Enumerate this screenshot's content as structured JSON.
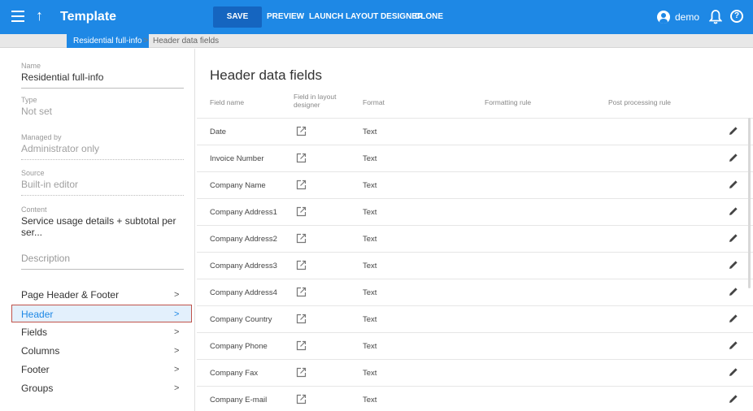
{
  "app": {
    "title": "Template",
    "up_icon": "arrow-up-icon",
    "menu_icon": "hamburger-menu-icon"
  },
  "toolbar": {
    "save_label": "SAVE",
    "preview_label": "PREVIEW",
    "launch_label": "LAUNCH LAYOUT DESIGNER",
    "clone_label": "CLONE"
  },
  "user": {
    "name": "demo",
    "icon": "account-icon",
    "bell_icon": "bell-icon",
    "help_icon": "help-icon"
  },
  "breadcrumb": {
    "current": "Residential full-info",
    "separator": ">",
    "sub": "Header data fields"
  },
  "details": {
    "name": {
      "label": "Name",
      "value": "Residential full-info"
    },
    "type": {
      "label": "Type",
      "value": "Not set"
    },
    "managed_by": {
      "label": "Managed by",
      "value": "Administrator only"
    },
    "source": {
      "label": "Source",
      "value": "Built-in editor"
    },
    "content": {
      "label": "Content",
      "value": "Service usage details + subtotal per ser..."
    },
    "description_placeholder": "Description"
  },
  "sections": [
    {
      "label": "Page Header & Footer",
      "chevron": ">"
    },
    {
      "label": "Header",
      "chevron": ">",
      "active": true
    },
    {
      "label": "Fields",
      "chevron": ">"
    },
    {
      "label": "Columns",
      "chevron": ">"
    },
    {
      "label": "Footer",
      "chevron": ">"
    },
    {
      "label": "Groups",
      "chevron": ">"
    }
  ],
  "main": {
    "title": "Header data fields",
    "columns": {
      "field_name": "Field name",
      "layout_line1": "Field in layout",
      "layout_line2": "designer",
      "format": "Format",
      "formatting_rule": "Formatting rule",
      "post_processing_rule": "Post processing rule"
    },
    "rows": [
      {
        "field": "Date",
        "format": "Text"
      },
      {
        "field": "Invoice Number",
        "format": "Text"
      },
      {
        "field": "Company Name",
        "format": "Text"
      },
      {
        "field": "Company Address1",
        "format": "Text"
      },
      {
        "field": "Company Address2",
        "format": "Text"
      },
      {
        "field": "Company Address3",
        "format": "Text"
      },
      {
        "field": "Company Address4",
        "format": "Text"
      },
      {
        "field": "Company Country",
        "format": "Text"
      },
      {
        "field": "Company Phone",
        "format": "Text"
      },
      {
        "field": "Company Fax",
        "format": "Text"
      },
      {
        "field": "Company E-mail",
        "format": "Text"
      }
    ],
    "row_link_icon": "open-in-layout-designer-icon",
    "row_edit_icon": "pencil-edit-icon"
  },
  "colors": {
    "primary": "#1e88e5",
    "save_button": "#1565c0",
    "active_border": "#c0524a",
    "active_background": "#e3f0fc"
  }
}
